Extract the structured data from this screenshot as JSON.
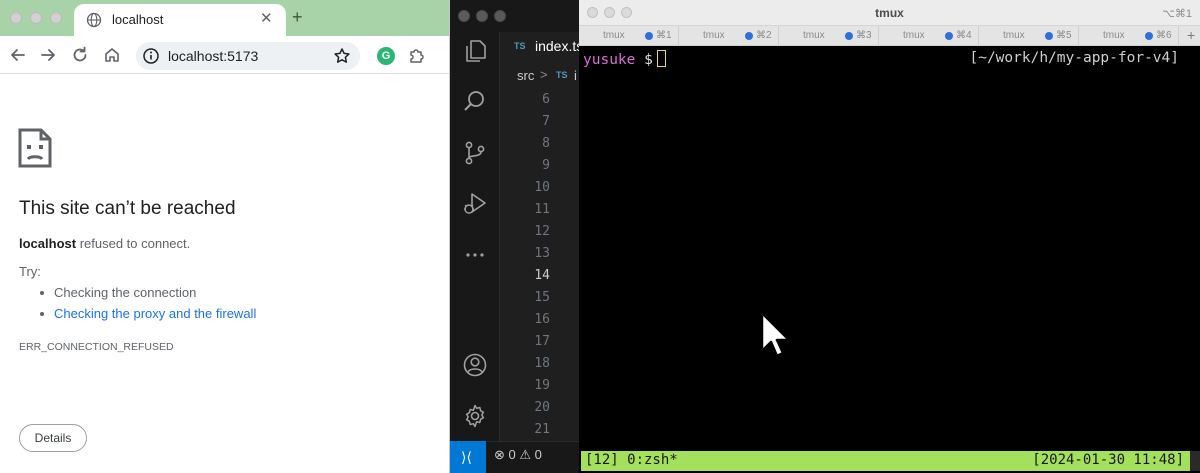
{
  "browser": {
    "tab_title": "localhost",
    "new_tab_label": "+",
    "url": "localhost:5173",
    "extension_letter": "G",
    "error": {
      "title": "This site can’t be reached",
      "host": "localhost",
      "message": " refused to connect.",
      "try_label": "Try:",
      "suggestions": [
        "Checking the connection",
        "Checking the proxy and the firewall"
      ],
      "code": "ERR_CONNECTION_REFUSED",
      "details_button": "Details"
    }
  },
  "vscode": {
    "tab_badge": "TS",
    "tab_filename": "index.ts",
    "breadcrumb_folder": "src",
    "breadcrumb_sep": ">",
    "breadcrumb_badge": "TS",
    "breadcrumb_file": "i",
    "line_numbers": [
      "6",
      "7",
      "8",
      "9",
      "10",
      "11",
      "12",
      "13",
      "14",
      "15",
      "16",
      "17",
      "18",
      "19",
      "20",
      "21"
    ],
    "active_line": "14",
    "remote_icon": "remote-icon",
    "errors": "0",
    "warnings": "0"
  },
  "terminal": {
    "window_title": "tmux",
    "shortcut": "⌥⌘1",
    "tabs": [
      {
        "name": "tmux",
        "shortcut": "⌘1"
      },
      {
        "name": "tmux",
        "shortcut": "⌘2"
      },
      {
        "name": "tmux",
        "shortcut": "⌘3"
      },
      {
        "name": "tmux",
        "shortcut": "⌘4"
      },
      {
        "name": "tmux",
        "shortcut": "⌘5"
      },
      {
        "name": "tmux",
        "shortcut": "⌘6"
      }
    ],
    "new_tab_label": "+",
    "prompt_user": "yusuke",
    "prompt_symbol": "$",
    "cwd": "[~/work/h/my-app-for-v4]",
    "status_left": "[12] 0:zsh*",
    "status_right": "[2024-01-30 11:48]"
  },
  "colors": {
    "browser_frame": "#a8d2a7",
    "link_blue": "#1a73e8",
    "vscode_accent": "#0078d4",
    "tmux_status": "#a3e05b",
    "prompt_user": "#d670d6"
  }
}
